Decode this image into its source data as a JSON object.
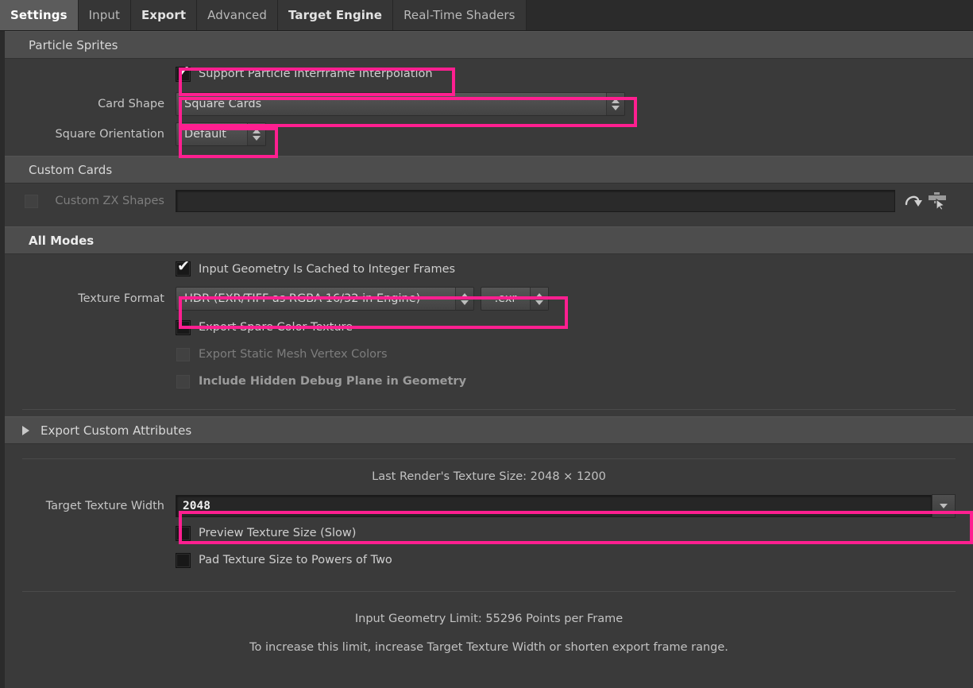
{
  "tabs": [
    {
      "label": "Settings",
      "state": "active"
    },
    {
      "label": "Input",
      "state": "normal"
    },
    {
      "label": "Export",
      "state": "bold"
    },
    {
      "label": "Advanced",
      "state": "normal"
    },
    {
      "label": "Target Engine",
      "state": "bold"
    },
    {
      "label": "Real-Time Shaders",
      "state": "normal"
    }
  ],
  "sections": {
    "particle_sprites": {
      "title": "Particle Sprites",
      "interframe": {
        "label": "Support Particle Interframe Interpolation",
        "checked": true,
        "check_glyph": "✔"
      },
      "card_shape": {
        "label": "Card Shape",
        "value": "Square Cards"
      },
      "square_orientation": {
        "label": "Square Orientation",
        "value": "Default"
      }
    },
    "custom_cards": {
      "title": "Custom Cards",
      "custom_zx_shapes": {
        "label": "Custom ZX Shapes",
        "checked": false,
        "disabled": true,
        "field_value": "",
        "reload_icon": "reload-icon",
        "pick_icon": "pick-object-icon"
      }
    },
    "all_modes": {
      "title": "All Modes",
      "cached_frames": {
        "label": "Input Geometry Is Cached to Integer Frames",
        "checked": true,
        "check_glyph": "✔"
      },
      "texture_format": {
        "label": "Texture Format",
        "value": "HDR (EXR/TIFF as RGBA 16/32 in Engine)",
        "extension": ".exr"
      },
      "checkboxes": [
        {
          "label": "Export Spare Color Texture",
          "checked": false,
          "disabled": false,
          "bold": false
        },
        {
          "label": "Export Static Mesh Vertex Colors",
          "checked": false,
          "disabled": true,
          "bold": false
        },
        {
          "label": "Include Hidden Debug Plane in Geometry",
          "checked": false,
          "disabled": true,
          "bold": true
        }
      ]
    },
    "export_custom_attributes": {
      "title": "Export Custom Attributes",
      "expanded": false,
      "arrow_icon": "triangle-right-icon"
    },
    "texture_size": {
      "last_render_label": "Last Render's Texture Size: 2048 × 1200",
      "target_width": {
        "label": "Target Texture Width",
        "value": "2048",
        "menu_icon": "triangle-down-icon"
      },
      "checkboxes": [
        {
          "label": "Preview Texture Size (Slow)",
          "checked": false
        },
        {
          "label": "Pad Texture Size to Powers of Two",
          "checked": false
        }
      ]
    },
    "footer": {
      "limit_text": "Input Geometry Limit: 55296 Points per Frame",
      "hint_text": "To increase this limit, increase Target Texture Width or shorten export frame range."
    }
  },
  "colors": {
    "highlight": "#ff1f90",
    "panel_bg": "#3a3a3a",
    "section_header_bg": "#4d4d4d",
    "tab_active_bg": "#5c5c5c"
  }
}
